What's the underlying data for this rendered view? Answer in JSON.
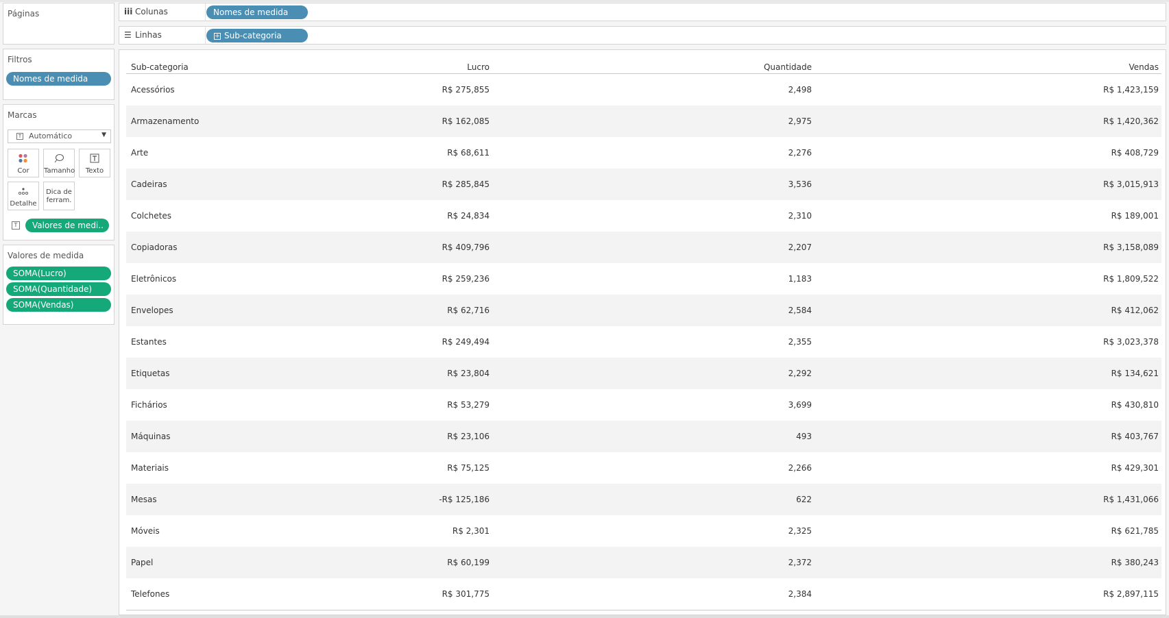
{
  "pages": {
    "title": "Páginas"
  },
  "filters": {
    "title": "Filtros",
    "pill": "Nomes de medida"
  },
  "marks": {
    "title": "Marcas",
    "type_select": "Automático",
    "buttons": [
      {
        "label": "Cor",
        "icon": "color-dots-icon"
      },
      {
        "label": "Tamanho",
        "icon": "size-lasso-icon"
      },
      {
        "label": "Texto",
        "icon": "text-t-icon"
      },
      {
        "label": "Detalhe",
        "icon": "detail-dots-icon"
      },
      {
        "label_line1": "Dica de",
        "label_line2": "ferram.",
        "icon": "none"
      }
    ],
    "text_pill": "Valores de medi.."
  },
  "measure_values": {
    "title": "Valores de medida",
    "pills": [
      "SOMA(Lucro)",
      "SOMA(Quantidade)",
      "SOMA(Vendas)"
    ]
  },
  "shelves": {
    "columns": {
      "label": "Colunas",
      "pill": "Nomes de medida",
      "icon": "columns-icon"
    },
    "rows": {
      "label": "Linhas",
      "pill": "Sub-categoria",
      "icon": "rows-icon"
    }
  },
  "table": {
    "headers": [
      "Sub-categoria",
      "Lucro",
      "Quantidade",
      "Vendas"
    ],
    "rows": [
      [
        "Acessórios",
        "R$ 275,855",
        "2,498",
        "R$ 1,423,159"
      ],
      [
        "Armazenamento",
        "R$ 162,085",
        "2,975",
        "R$ 1,420,362"
      ],
      [
        "Arte",
        "R$ 68,611",
        "2,276",
        "R$ 408,729"
      ],
      [
        "Cadeiras",
        "R$ 285,845",
        "3,536",
        "R$ 3,015,913"
      ],
      [
        "Colchetes",
        "R$ 24,834",
        "2,310",
        "R$ 189,001"
      ],
      [
        "Copiadoras",
        "R$ 409,796",
        "2,207",
        "R$ 3,158,089"
      ],
      [
        "Eletrônicos",
        "R$ 259,236",
        "1,183",
        "R$ 1,809,522"
      ],
      [
        "Envelopes",
        "R$ 62,716",
        "2,584",
        "R$ 412,062"
      ],
      [
        "Estantes",
        "R$ 249,494",
        "2,355",
        "R$ 3,023,378"
      ],
      [
        "Etiquetas",
        "R$ 23,804",
        "2,292",
        "R$ 134,621"
      ],
      [
        "Fichários",
        "R$ 53,279",
        "3,699",
        "R$ 430,810"
      ],
      [
        "Máquinas",
        "R$ 23,106",
        "493",
        "R$ 403,767"
      ],
      [
        "Materiais",
        "R$ 75,125",
        "2,266",
        "R$ 429,301"
      ],
      [
        "Mesas",
        "-R$ 125,186",
        "622",
        "R$ 1,431,066"
      ],
      [
        "Móveis",
        "R$ 2,301",
        "2,325",
        "R$ 621,785"
      ],
      [
        "Papel",
        "R$ 60,199",
        "2,372",
        "R$ 380,243"
      ],
      [
        "Telefones",
        "R$ 301,775",
        "2,384",
        "R$ 2,897,115"
      ]
    ]
  },
  "colors": {
    "pill_blue": "#4a8fb3",
    "pill_green": "#15a878",
    "row_alt": "#f3f3f3"
  }
}
